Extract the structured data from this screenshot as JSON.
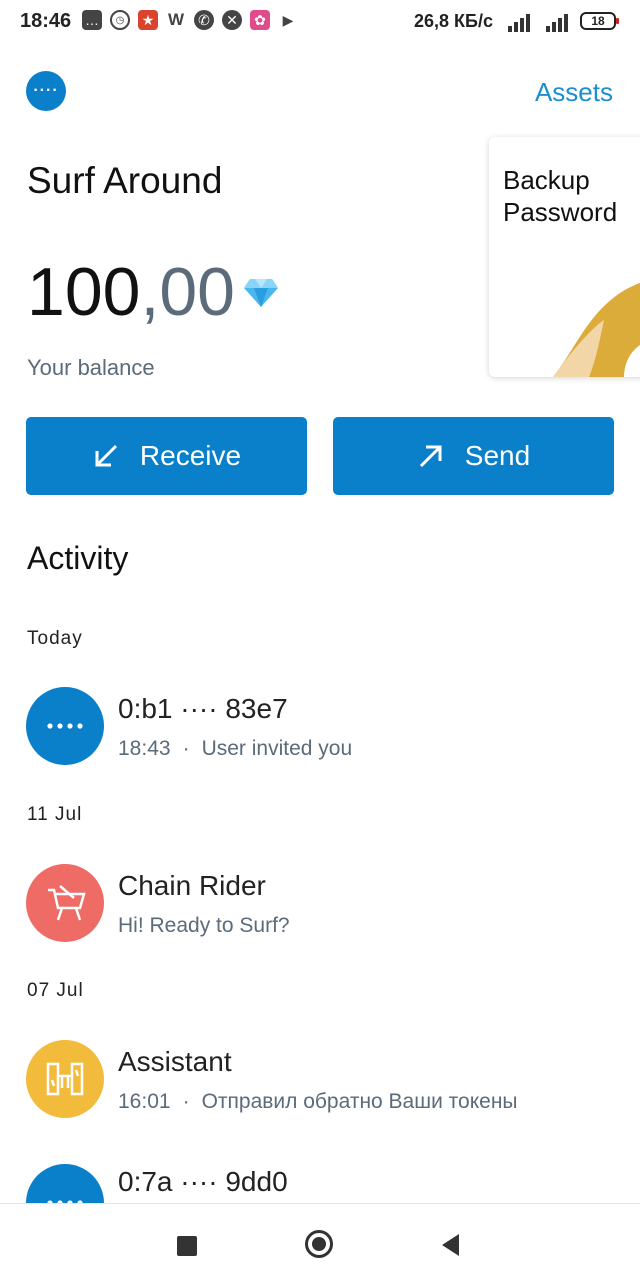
{
  "status_bar": {
    "time": "18:46",
    "network_speed": "26,8 КБ/с",
    "battery": "18",
    "icons": [
      "message-icon",
      "alarm-icon",
      "app-icon",
      "w-app-icon",
      "whatsapp-icon",
      "shortcut-icon",
      "gallery-icon",
      "play-icon"
    ]
  },
  "header": {
    "menu_label": "····",
    "assets_label": "Assets"
  },
  "wallet": {
    "name": "Surf Around",
    "balance_int": "100",
    "balance_dec": ",00",
    "balance_label": "Your balance",
    "currency_icon": "gem-icon"
  },
  "backup_card": {
    "title": "Backup Password"
  },
  "actions": {
    "receive_label": "Receive",
    "send_label": "Send"
  },
  "activity": {
    "title": "Activity",
    "groups": [
      {
        "date": "Today",
        "items": [
          {
            "title": "0:b1 ···· 83e7",
            "time": "18:43",
            "message": "User invited you",
            "avatar_color": "#0a7fca",
            "avatar_icon": "ellipsis-icon"
          }
        ]
      },
      {
        "date": "11 Jul",
        "items": [
          {
            "title": "Chain Rider",
            "time": "",
            "message": "Hi! Ready to Surf?",
            "avatar_color": "#ef6b66",
            "avatar_icon": "cart-icon"
          }
        ]
      },
      {
        "date": "07 Jul",
        "items": [
          {
            "title": "Assistant",
            "time": "16:01",
            "message": "Отправил обратно Ваши токены",
            "avatar_color": "#f2bb3c",
            "avatar_icon": "assistant-icon"
          },
          {
            "title": "0:7a ···· 9dd0",
            "time": "",
            "message": "",
            "avatar_color": "#0a7fca",
            "avatar_icon": "ellipsis-icon"
          }
        ]
      }
    ]
  },
  "colors": {
    "accent": "#0a7fca",
    "link": "#1b8fd0",
    "secondary_text": "#5b6b7a"
  }
}
